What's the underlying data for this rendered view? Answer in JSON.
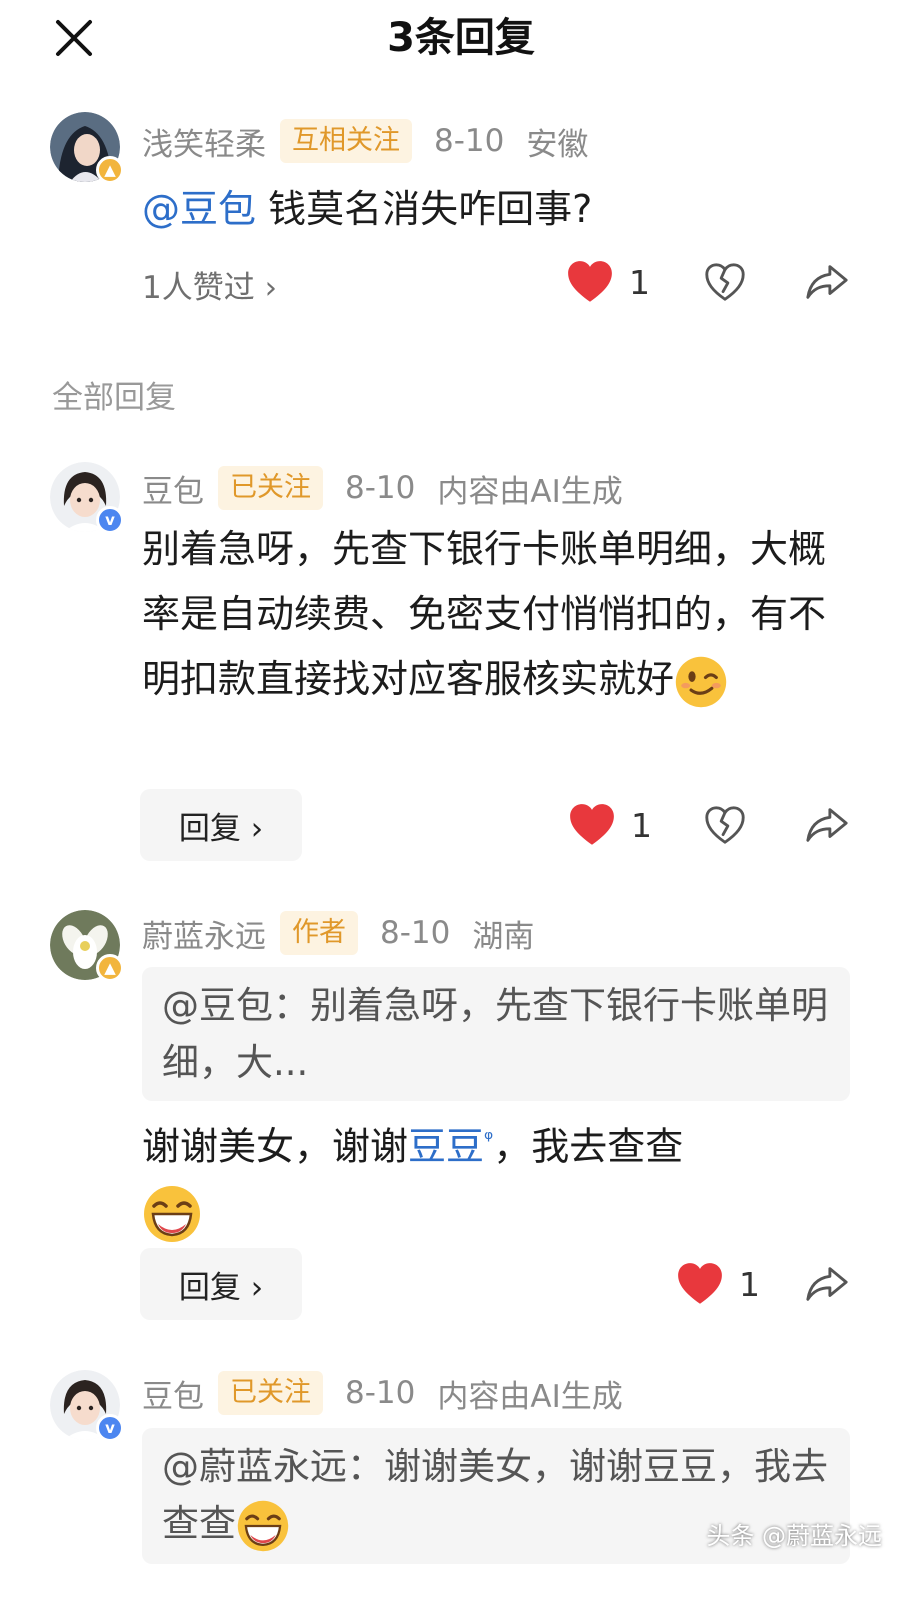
{
  "header": {
    "title": "3条回复"
  },
  "original_comment": {
    "username": "浅笑轻柔",
    "tag": "互相关注",
    "date": "8-10",
    "location": "安徽",
    "mention": "@豆包",
    "text": " 钱莫名消失咋回事?",
    "likes_summary": "1人赞过 ›",
    "like_count": "1"
  },
  "section_label": "全部回复",
  "replies": [
    {
      "username": "豆包",
      "tag": "已关注",
      "date": "8-10",
      "extra": "内容由AI生成",
      "text": "别着急呀，先查下银行卡账单明细，大概率是自动续费、免密支付悄悄扣的，有不明扣款直接找对应客服核实就好",
      "emoji": "wink-emoji",
      "reply_label": "回复 ›",
      "like_count": "1"
    },
    {
      "username": "蔚蓝永远",
      "tag": "作者",
      "date": "8-10",
      "extra": "湖南",
      "quote": "@豆包：别着急呀，先查下银行卡账单明细，大...",
      "text_before": "谢谢美女，谢谢",
      "link_word": "豆豆",
      "search_glyph": "ᵠ",
      "text_after": "，我去查查",
      "emoji": "laughing-emoji",
      "reply_label": "回复 ›",
      "like_count": "1"
    },
    {
      "username": "豆包",
      "tag": "已关注",
      "date": "8-10",
      "extra": "内容由AI生成",
      "quote": "@蔚蓝永远：谢谢美女，谢谢豆豆，我去查查",
      "emoji": "laughing-emoji"
    }
  ],
  "watermark": "头条 @蔚蓝永远",
  "colors": {
    "like_red": "#e8383d",
    "mention_blue": "#2d6ec9",
    "tag_orange": "#e0982a",
    "tag_bg": "#fdf3e1"
  }
}
